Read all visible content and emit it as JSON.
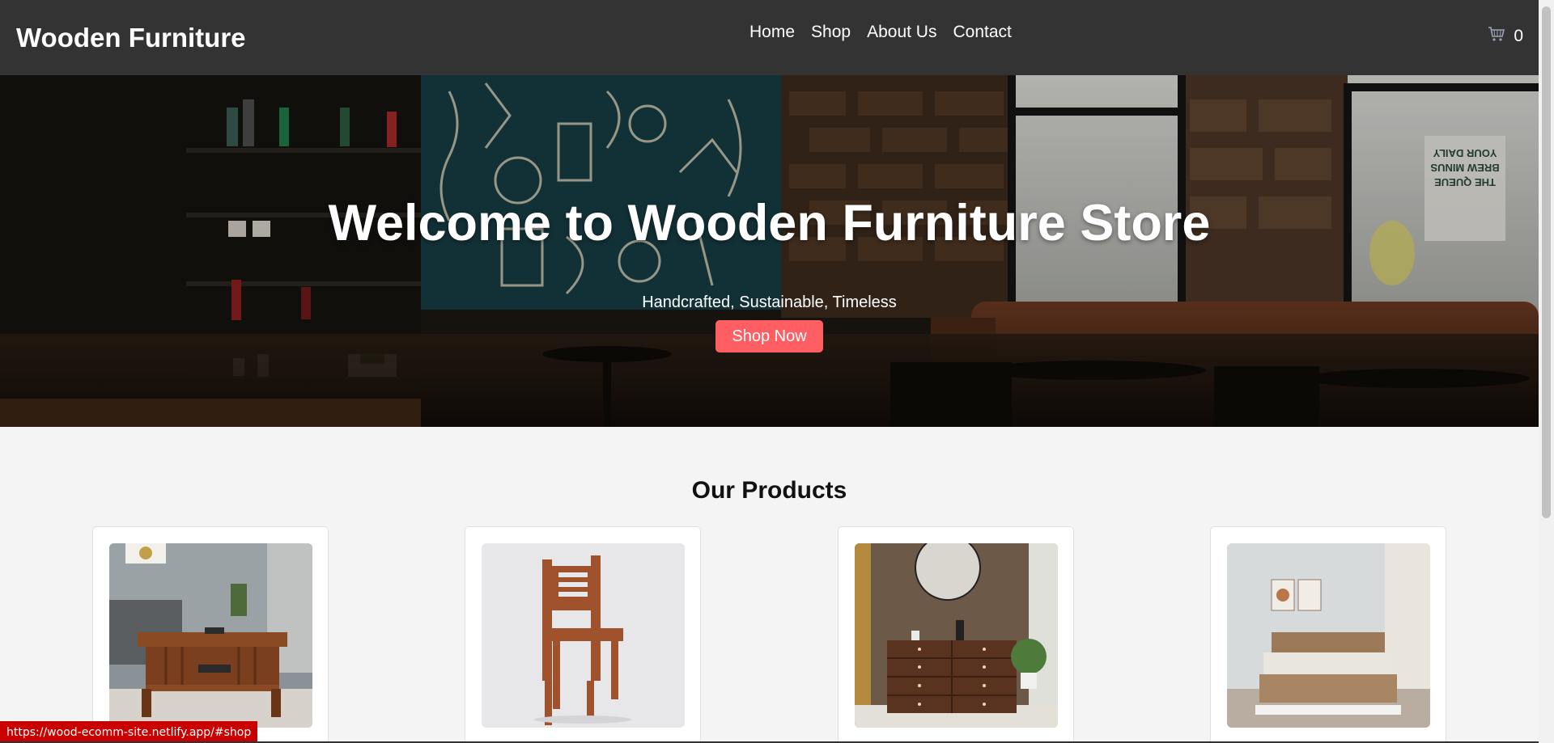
{
  "header": {
    "logo": "Wooden Furniture",
    "nav": [
      "Home",
      "Shop",
      "About Us",
      "Contact"
    ],
    "cart_count": "0",
    "cart_icon": "cart-icon"
  },
  "hero": {
    "title": "Welcome to Wooden Furniture Store",
    "subtitle": "Handcrafted, Sustainable, Timeless",
    "button": "Shop Now",
    "sign_text": [
      "YOUR DAILY",
      "BREW MINUS",
      "THE QUEUE"
    ]
  },
  "products": {
    "title": "Our Products",
    "items": [
      {
        "name": "coffee-table-image"
      },
      {
        "name": "wooden-chair-image"
      },
      {
        "name": "chest-of-drawers-image"
      },
      {
        "name": "wooden-bed-image"
      }
    ]
  },
  "status_bar": {
    "url": "https://wood-ecomm-site.netlify.app/#shop"
  },
  "colors": {
    "header_bg": "#333333",
    "accent": "#ff5e62",
    "page_bg": "#f4f4f4"
  }
}
